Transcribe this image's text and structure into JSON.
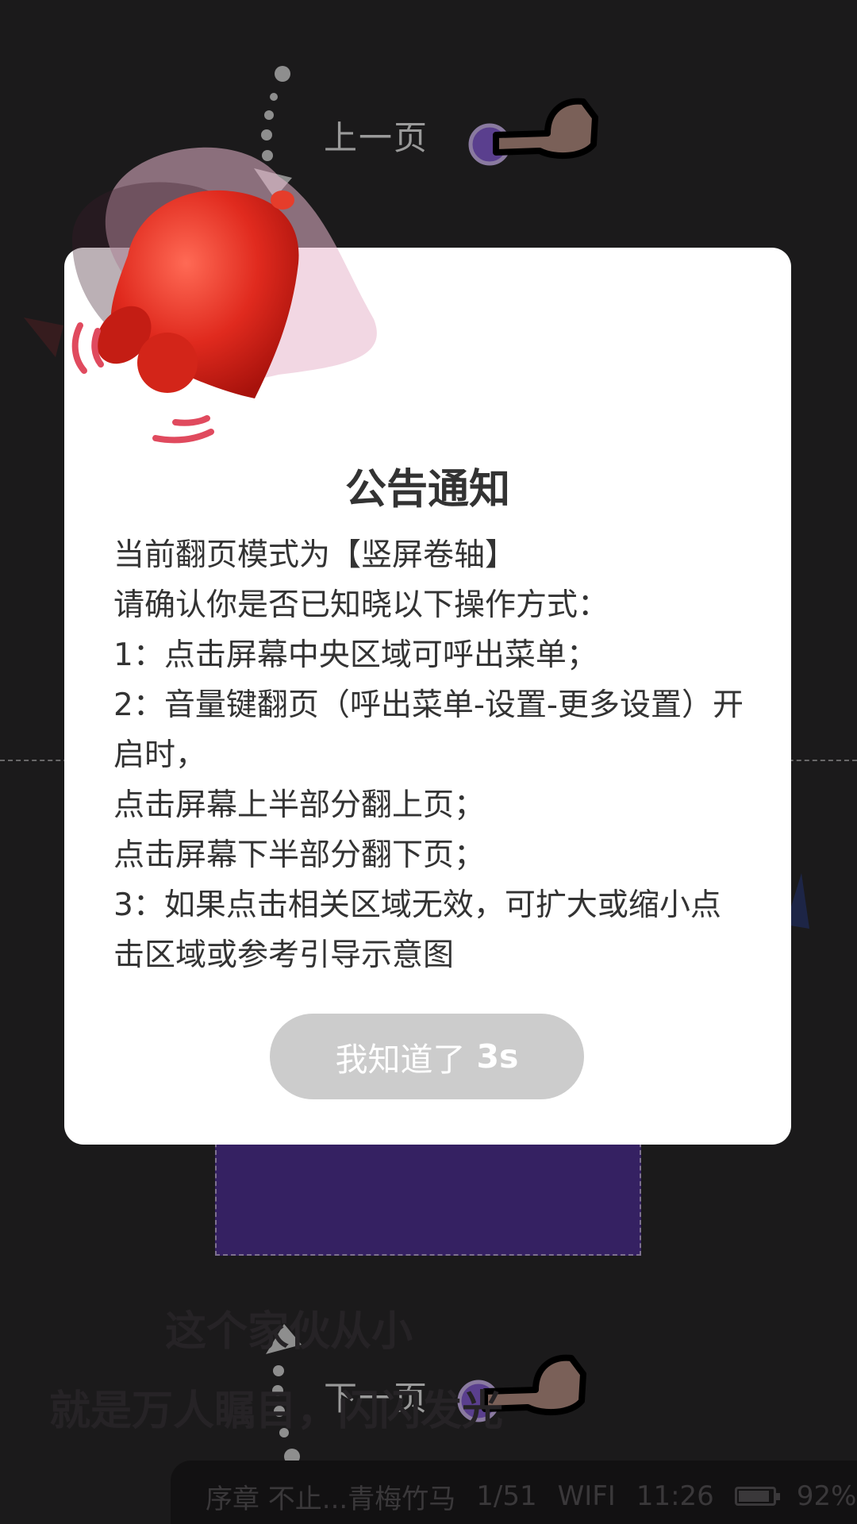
{
  "reader": {
    "guide_prev_label": "上一页",
    "guide_next_label": "下一页",
    "story_lines": [
      "这个家伙从小",
      "就是万人瞩目，闪闪发光"
    ]
  },
  "status_bar": {
    "chapter": "序章 不止...青梅竹马",
    "page": "1/51",
    "network": "WIFI",
    "time": "11:26",
    "battery": "92%",
    "battery_level": 0.92
  },
  "dialog": {
    "title": "公告通知",
    "body_lines": [
      "当前翻页模式为【竖屏卷轴】",
      "请确认你是否已知晓以下操作方式：",
      "1：点击屏幕中央区域可呼出菜单；",
      "2：音量键翻页（呼出菜单-设置-更多设置）开启时，",
      "点击屏幕上半部分翻上页；",
      "点击屏幕下半部分翻下页；",
      "3：如果点击相关区域无效，可扩大或缩小点击区域或参考引导示意图"
    ],
    "confirm_label": "我知道了",
    "confirm_countdown": "3s",
    "confirm_color": "#cccccc"
  },
  "icons": {
    "notification": "bell-icon",
    "tap_hint": "pointing-hand-icon",
    "arrow_up": "arrow-up-icon",
    "arrow_down": "arrow-down-icon"
  },
  "colors": {
    "background": "#1b1a1b",
    "panel": "#352162",
    "bell": "#e02a1e"
  }
}
